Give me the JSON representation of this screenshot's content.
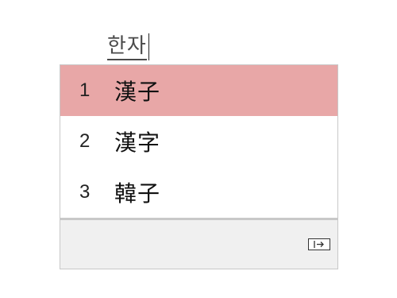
{
  "composition": {
    "text": "한자"
  },
  "candidates": [
    {
      "number": "1",
      "text": "漢子",
      "selected": true
    },
    {
      "number": "2",
      "text": "漢字",
      "selected": false
    },
    {
      "number": "3",
      "text": "韓子",
      "selected": false
    }
  ],
  "footer": {
    "expand_icon": "expand-arrow-icon"
  },
  "colors": {
    "selected_background": "#e8a7a7",
    "footer_background": "#f0f0f0",
    "border": "#c8c8c8"
  }
}
